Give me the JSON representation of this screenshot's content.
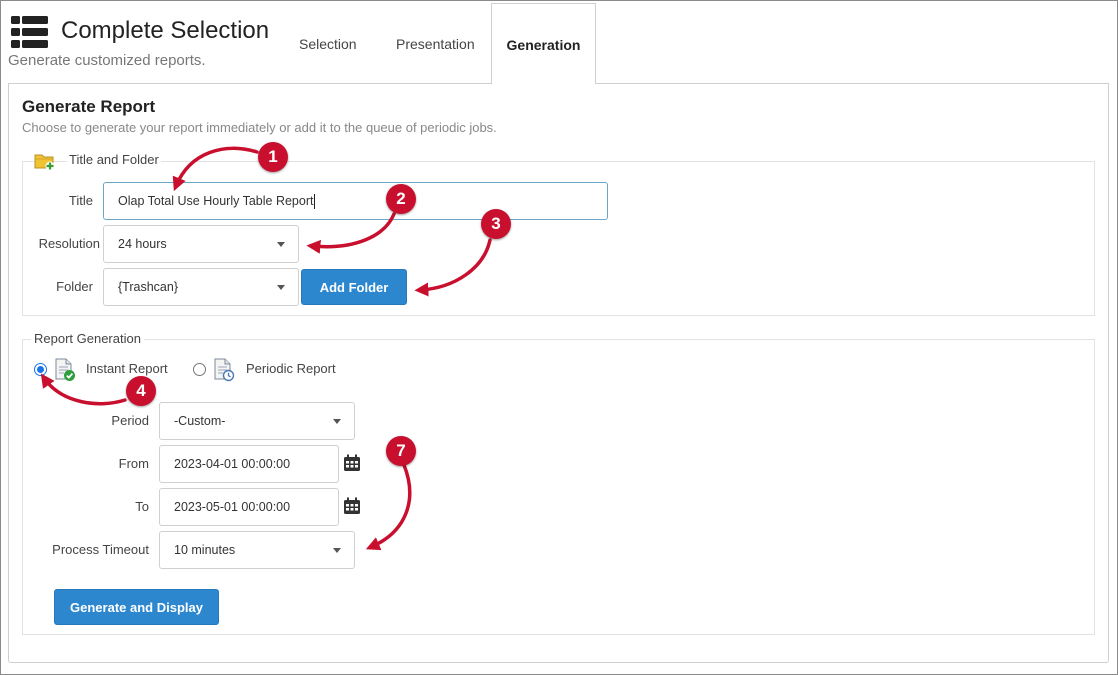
{
  "header": {
    "title": "Complete Selection",
    "subtitle": "Generate customized reports."
  },
  "tabs": [
    {
      "label": "Selection"
    },
    {
      "label": "Presentation"
    },
    {
      "label": "Generation"
    }
  ],
  "section": {
    "title": "Generate Report",
    "description": "Choose to generate your report immediately or add it to the queue of periodic jobs."
  },
  "title_folder": {
    "legend": "Title and Folder",
    "title_label": "Title",
    "title_value": "Olap Total Use Hourly Table Report",
    "resolution_label": "Resolution",
    "resolution_value": "24 hours",
    "folder_label": "Folder",
    "folder_value": "{Trashcan}",
    "add_folder_button": "Add Folder"
  },
  "report_generation": {
    "legend": "Report Generation",
    "instant_label": "Instant Report",
    "periodic_label": "Periodic Report",
    "period_label": "Period",
    "period_value": "-Custom-",
    "from_label": "From",
    "from_value": "2023-04-01 00:00:00",
    "to_label": "To",
    "to_value": "2023-05-01 00:00:00",
    "timeout_label": "Process Timeout",
    "timeout_value": "10 minutes",
    "generate_button": "Generate and Display"
  },
  "callouts": [
    "1",
    "2",
    "3",
    "4",
    "7"
  ],
  "colors": {
    "accent": "#2d87cf",
    "callout": "#c8102e",
    "focus_border": "#6aa7c7"
  },
  "icons": {
    "app": "table-list-icon",
    "folder": "folder-add-icon",
    "instant": "document-check-icon",
    "periodic": "document-clock-icon",
    "calendar": "calendar-icon"
  }
}
